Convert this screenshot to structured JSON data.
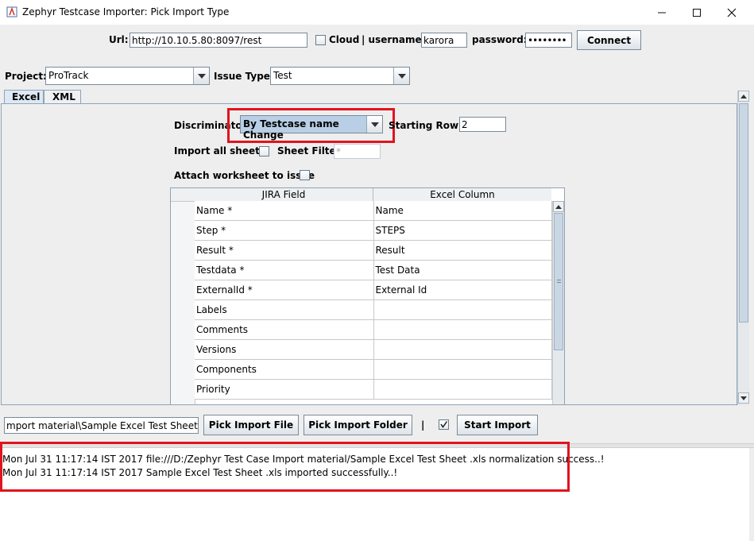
{
  "window": {
    "title": "Zephyr Testcase Importer: Pick Import Type"
  },
  "connection": {
    "url_label": "Url:",
    "url_value": "http://10.10.5.80:8097/rest",
    "cloud_label": "Cloud",
    "username_label": "| username:",
    "username_value": "karora",
    "password_label": "password:",
    "password_value": "••••••••",
    "connect_label": "Connect"
  },
  "project": {
    "project_label": "Project:",
    "project_value": "ProTrack",
    "issue_type_label": "Issue Type:",
    "issue_type_value": "Test"
  },
  "tabs": [
    {
      "label": "Excel",
      "selected": true
    },
    {
      "label": "XML",
      "selected": false
    }
  ],
  "excel": {
    "discriminator_label": "Discriminator:",
    "discriminator_value": "By Testcase name Change",
    "starting_row_label": "Starting Row #:",
    "starting_row_value": "2",
    "import_all_label": "Import all sheets:",
    "sheet_filter_label": "Sheet Filter:",
    "sheet_filter_placeholder": "*",
    "attach_label": "Attach worksheet to issue"
  },
  "mapping_table": {
    "columns": [
      "JIRA Field",
      "Excel Column"
    ],
    "rows": [
      [
        "Name *",
        "Name"
      ],
      [
        "Step *",
        "STEPS"
      ],
      [
        "Result *",
        "Result"
      ],
      [
        "Testdata *",
        "Test Data"
      ],
      [
        "ExternalId *",
        "External Id"
      ],
      [
        "Labels",
        ""
      ],
      [
        "Comments",
        ""
      ],
      [
        "Versions",
        ""
      ],
      [
        "Components",
        ""
      ],
      [
        "Priority",
        ""
      ]
    ]
  },
  "bottom": {
    "file_path": "mport material\\Sample Excel Test Sheet .xls",
    "pick_file_label": "Pick Import File",
    "pick_folder_label": "Pick Import Folder",
    "separator": "|",
    "start_label": "Start Import"
  },
  "log": [
    "Mon Jul 31 11:17:14 IST 2017 file:///D:/Zephyr Test Case Import material/Sample Excel Test Sheet .xls normalization success..!",
    "Mon Jul 31 11:17:14 IST 2017 Sample Excel Test Sheet .xls imported successfully..!"
  ],
  "colors": {
    "highlight_red": "#e0141e",
    "combo_selected": "#b8cfe5"
  }
}
